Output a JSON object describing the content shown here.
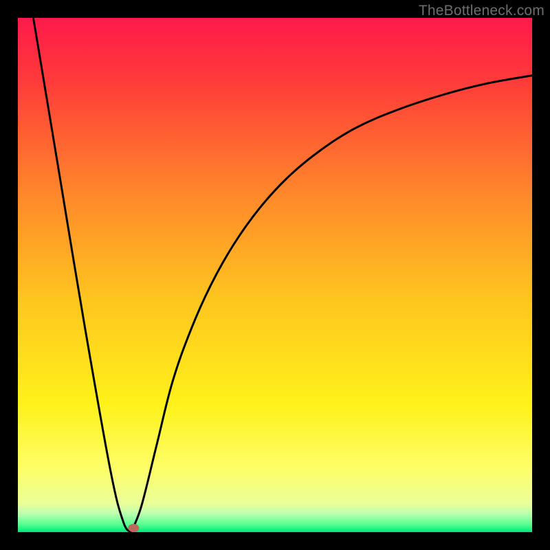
{
  "watermark": "TheBottleneck.com",
  "chart_data": {
    "type": "line",
    "title": "",
    "xlabel": "",
    "ylabel": "",
    "xlim": [
      0,
      100
    ],
    "ylim": [
      0,
      100
    ],
    "gradient_stops": [
      {
        "offset": 0.0,
        "color": "#ff1a4b"
      },
      {
        "offset": 0.12,
        "color": "#ff3a3a"
      },
      {
        "offset": 0.35,
        "color": "#ff8a2a"
      },
      {
        "offset": 0.55,
        "color": "#ffc61f"
      },
      {
        "offset": 0.75,
        "color": "#fff11a"
      },
      {
        "offset": 0.88,
        "color": "#fdff6a"
      },
      {
        "offset": 0.945,
        "color": "#eaff9a"
      },
      {
        "offset": 0.965,
        "color": "#b9ffb0"
      },
      {
        "offset": 0.985,
        "color": "#55ff90"
      },
      {
        "offset": 1.0,
        "color": "#00e67a"
      }
    ],
    "series": [
      {
        "name": "curve-left",
        "x": [
          3.0,
          8.0,
          13.0,
          18.0,
          20.5,
          22.0
        ],
        "y": [
          100.0,
          70.0,
          40.0,
          12.0,
          2.0,
          0.0
        ]
      },
      {
        "name": "curve-right",
        "x": [
          22.0,
          24.0,
          27.0,
          30.0,
          33.5,
          37.5,
          42.0,
          47.0,
          52.5,
          58.5,
          65.5,
          73.5,
          82.5,
          91.0,
          100.0
        ],
        "y": [
          0.0,
          5.0,
          17.0,
          29.0,
          39.0,
          48.0,
          56.0,
          63.0,
          69.0,
          74.0,
          78.5,
          82.0,
          85.0,
          87.2,
          88.8
        ]
      }
    ],
    "marker": {
      "x": 22.5,
      "y": 0.8,
      "color": "#bb6b5e"
    }
  }
}
